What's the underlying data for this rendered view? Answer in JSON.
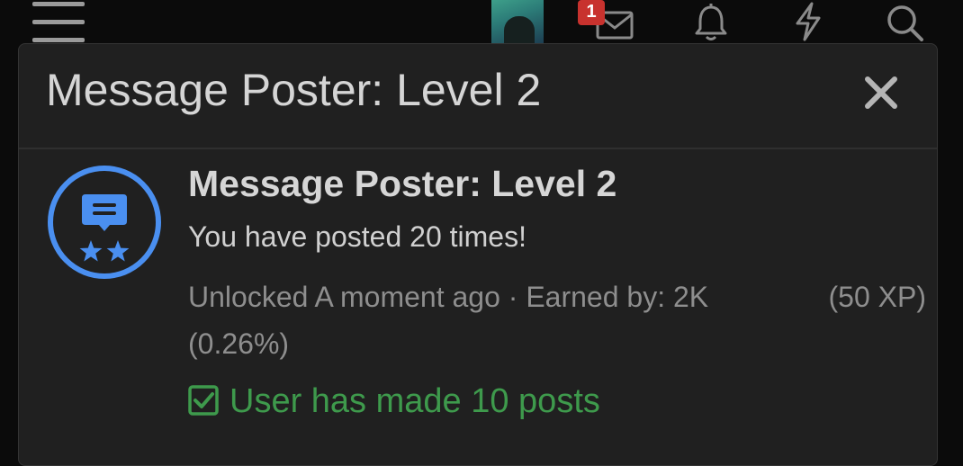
{
  "topbar": {
    "menu_icon": "hamburger-icon",
    "avatar_icon": "avatar",
    "inbox_icon": "envelope-icon",
    "inbox_badge": "1",
    "alerts_icon": "bell-icon",
    "whats_new_icon": "lightning-icon",
    "search_icon": "search-icon"
  },
  "dialog": {
    "title": "Message Poster: Level 2",
    "close_icon": "close-icon"
  },
  "trophy": {
    "icon": "speech-bubble-stars-icon",
    "title": "Message Poster: Level 2",
    "description": "You have posted 20 times!",
    "meta_unlocked": "Unlocked A moment ago · Earned by: 2K",
    "meta_xp": "(50 XP)",
    "meta_percent": "(0.26%)",
    "criteria_icon": "checkbox-checked-icon",
    "criteria": "User has made 10 posts"
  },
  "colors": {
    "background": "#0b0b0b",
    "dialog": "#202020",
    "accent_blue": "#4a8ff0",
    "success_green": "#3e9a4c",
    "badge_red": "#c8322e"
  }
}
